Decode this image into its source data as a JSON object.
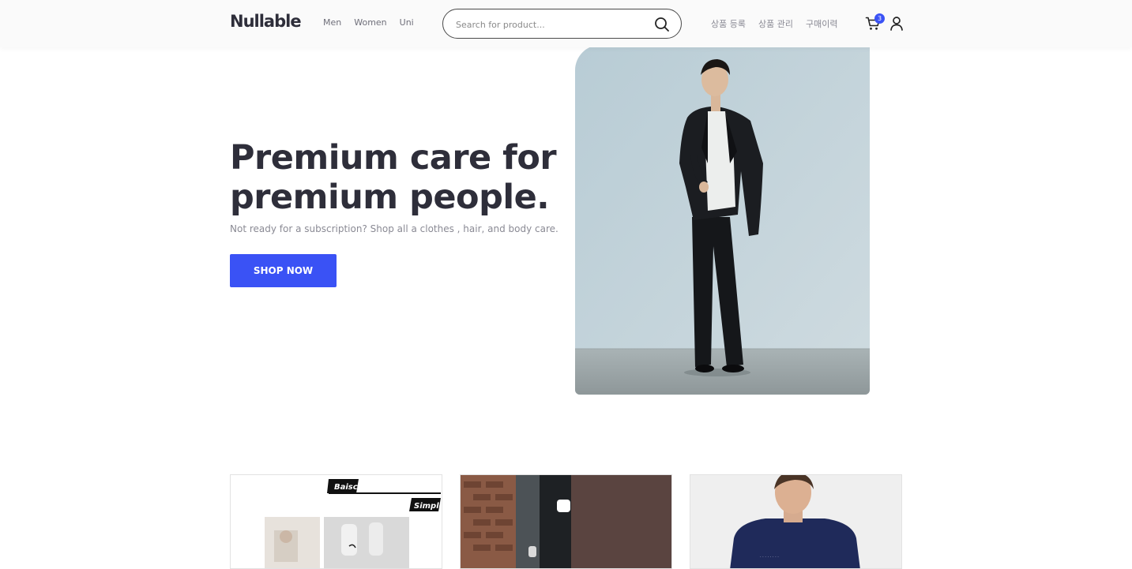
{
  "header": {
    "logo": "Nullable",
    "nav": [
      "Men",
      "Women",
      "Uni"
    ],
    "search": {
      "placeholder": "Search for product...",
      "value": ""
    },
    "admin_menu": [
      "상품 등록",
      "상품 관리",
      "구매이력"
    ],
    "cart_count": "3",
    "icons": {
      "search": "search-icon",
      "cart": "cart-icon",
      "user": "user-icon"
    }
  },
  "hero": {
    "title_line1": "Premium care for",
    "title_line2": "premium people.",
    "subtitle": "Not ready for a subscription? Shop all a clothes , hair, and body care.",
    "cta": "SHOP NOW"
  },
  "products": {
    "card1": {
      "label_top": "Baisc",
      "label_bottom": "Simple"
    },
    "card2": {},
    "card3": {}
  },
  "colors": {
    "accent": "#3a52f5",
    "text": "#2e2e3a",
    "muted": "#8a8a94",
    "header_bg": "#fafafa"
  }
}
